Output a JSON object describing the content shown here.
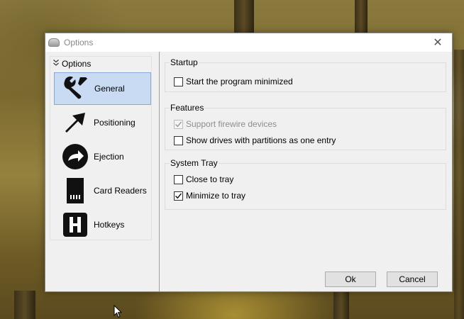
{
  "window": {
    "title": "Options",
    "close_glyph": "✕"
  },
  "sidebar": {
    "header": "Options",
    "header_icon": "double-chevron-down-icon",
    "items": [
      {
        "label": "General",
        "icon": "wrench-icon",
        "selected": true
      },
      {
        "label": "Positioning",
        "icon": "arrow-icon",
        "selected": false
      },
      {
        "label": "Ejection",
        "icon": "eject-arrow-icon",
        "selected": false
      },
      {
        "label": "Card Readers",
        "icon": "sd-card-icon",
        "selected": false
      },
      {
        "label": "Hotkeys",
        "icon": "h-key-icon",
        "selected": false
      }
    ]
  },
  "groups": {
    "startup": {
      "title": "Startup",
      "options": [
        {
          "label": "Start the program minimized",
          "checked": false,
          "disabled": false
        }
      ]
    },
    "features": {
      "title": "Features",
      "options": [
        {
          "label": "Support firewire devices",
          "checked": true,
          "disabled": true
        },
        {
          "label": "Show drives with partitions as one entry",
          "checked": false,
          "disabled": false
        }
      ]
    },
    "tray": {
      "title": "System Tray",
      "options": [
        {
          "label": "Close to tray",
          "checked": false,
          "disabled": false
        },
        {
          "label": "Minimize to tray",
          "checked": true,
          "disabled": false
        }
      ]
    }
  },
  "buttons": {
    "ok": "Ok",
    "cancel": "Cancel"
  },
  "colors": {
    "selected_bg": "#c9dbf3",
    "selected_border": "#88a8d8",
    "dialog_bg": "#f0f0f0"
  }
}
